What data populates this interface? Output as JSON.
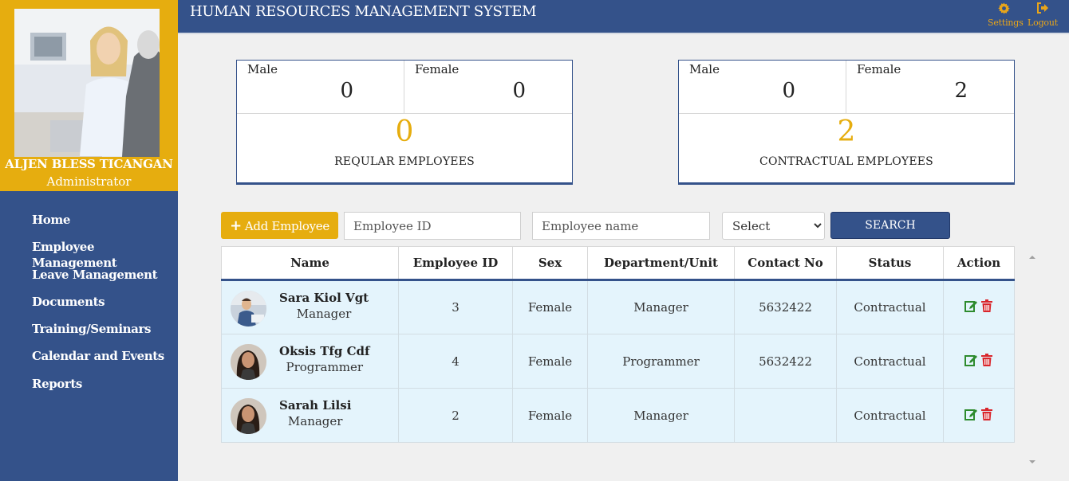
{
  "app": {
    "title": "HUMAN RESOURCES MANAGEMENT SYSTEM"
  },
  "header": {
    "settings_label": "Settings",
    "logout_label": "Logout",
    "settings_icon": "gear-icon",
    "logout_icon": "logout-icon"
  },
  "user": {
    "name": "ALJEN BLESS TICANGAN",
    "role": "Administrator"
  },
  "sidebar": {
    "items": [
      {
        "label": "Home"
      },
      {
        "label": "Employee Management"
      },
      {
        "label": "Leave Management"
      },
      {
        "label": "Documents"
      },
      {
        "label": "Training/Seminars"
      },
      {
        "label": "Calendar and Events"
      },
      {
        "label": "Reports"
      }
    ]
  },
  "stats": {
    "regular": {
      "male_label": "Male",
      "male": "0",
      "female_label": "Female",
      "female": "0",
      "total": "0",
      "caption": "REQULAR EMPLOYEES"
    },
    "contractual": {
      "male_label": "Male",
      "male": "0",
      "female_label": "Female",
      "female": "2",
      "total": "2",
      "caption": "CONTRACTUAL EMPLOYEES"
    }
  },
  "toolbar": {
    "add_label": "Add Employee",
    "employee_id_placeholder": "Employee ID",
    "employee_name_placeholder": "Employee name",
    "select_value": "Select",
    "search_label": "SEARCH"
  },
  "table": {
    "columns": [
      "Name",
      "Employee ID",
      "Sex",
      "Department/Unit",
      "Contact No",
      "Status",
      "Action"
    ],
    "rows": [
      {
        "name": "Sara Kiol Vgt",
        "position": "Manager",
        "employee_id": "3",
        "sex": "Female",
        "department": "Manager",
        "contact": "5632422",
        "status": "Contractual"
      },
      {
        "name": "Oksis Tfg Cdf",
        "position": "Programmer",
        "employee_id": "4",
        "sex": "Female",
        "department": "Programmer",
        "contact": "5632422",
        "status": "Contractual"
      },
      {
        "name": "Sarah Lilsi",
        "position": "Manager",
        "employee_id": "2",
        "sex": "Female",
        "department": "Manager",
        "contact": "",
        "status": "Contractual"
      }
    ]
  },
  "colors": {
    "navy": "#34528a",
    "gold": "#e6ad0f",
    "row_bg": "#e4f4fc",
    "edit": "#2e8b2e",
    "delete": "#d9262c"
  }
}
